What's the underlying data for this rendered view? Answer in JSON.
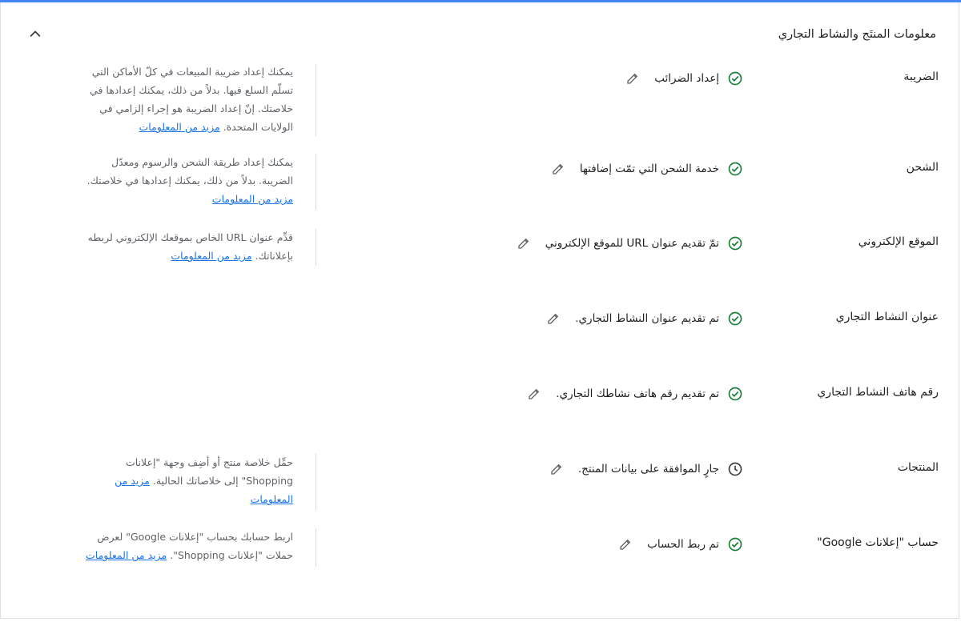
{
  "section": {
    "title": "معلومات المنتَج والنشاط التجاري",
    "collapse_icon": "chevron-up-icon"
  },
  "rows": [
    {
      "label": "الضريبة",
      "status_icon": "check-circle-icon",
      "status_text": "إعداد الضرائب",
      "help_text": "يمكنك إعداد ضريبة المبيعات في كلّ الأماكن التي تسلّم السلع فيها. بدلاً من ذلك، يمكنك إعدادها في خلاصتك. إنّ إعداد الضريبة هو إجراء إلزامي في الولايات المتحدة.",
      "help_link": "مزيد من المعلومات"
    },
    {
      "label": "الشحن",
      "status_icon": "check-circle-icon",
      "status_text": "خدمة الشحن التي تمّت إضافتها",
      "help_text": "يمكنك إعداد طريقة الشحن والرسوم ومعدّل الضريبة. بدلاً من ذلك، يمكنك إعدادها في خلاصتك.",
      "help_link": "مزيد من المعلومات"
    },
    {
      "label": "الموقع الإلكتروني",
      "status_icon": "check-circle-icon",
      "status_text": "تمّ تقديم عنوان URL للموقع الإلكتروني",
      "help_text": "قدِّم عنوان URL الخاص بموقعك الإلكتروني لربطه بإعلاناتك.",
      "help_link": "مزيد من المعلومات"
    },
    {
      "label": "عنوان النشاط التجاري",
      "status_icon": "check-circle-icon",
      "status_text": "تم تقديم عنوان النشاط التجاري.",
      "help_text": "",
      "help_link": ""
    },
    {
      "label": "رقم هاتف النشاط التجاري",
      "status_icon": "check-circle-icon",
      "status_text": "تم تقديم رقم هاتف نشاطك التجاري.",
      "help_text": "",
      "help_link": ""
    },
    {
      "label": "المنتجات",
      "status_icon": "clock-icon",
      "status_text": "جارٍ الموافقة على بيانات المنتج.",
      "help_text": "حمِّل خلاصة منتج أو أضِف وجهة \"إعلانات Shopping\" إلى خلاصاتك الحالية.",
      "help_link": "مزيد من المعلومات"
    },
    {
      "label": "حساب \"إعلانات Google\"",
      "status_icon": "check-circle-icon",
      "status_text": "تم ربط الحساب",
      "help_text": "اربط حسابك بحساب \"إعلانات Google\" لعرض حملات \"إعلانات Shopping\".",
      "help_link": "مزيد من المعلومات"
    }
  ],
  "colors": {
    "check": "#188038",
    "clock": "#3c4043",
    "link": "#1a73e8",
    "accent_bar": "#4285f4"
  }
}
